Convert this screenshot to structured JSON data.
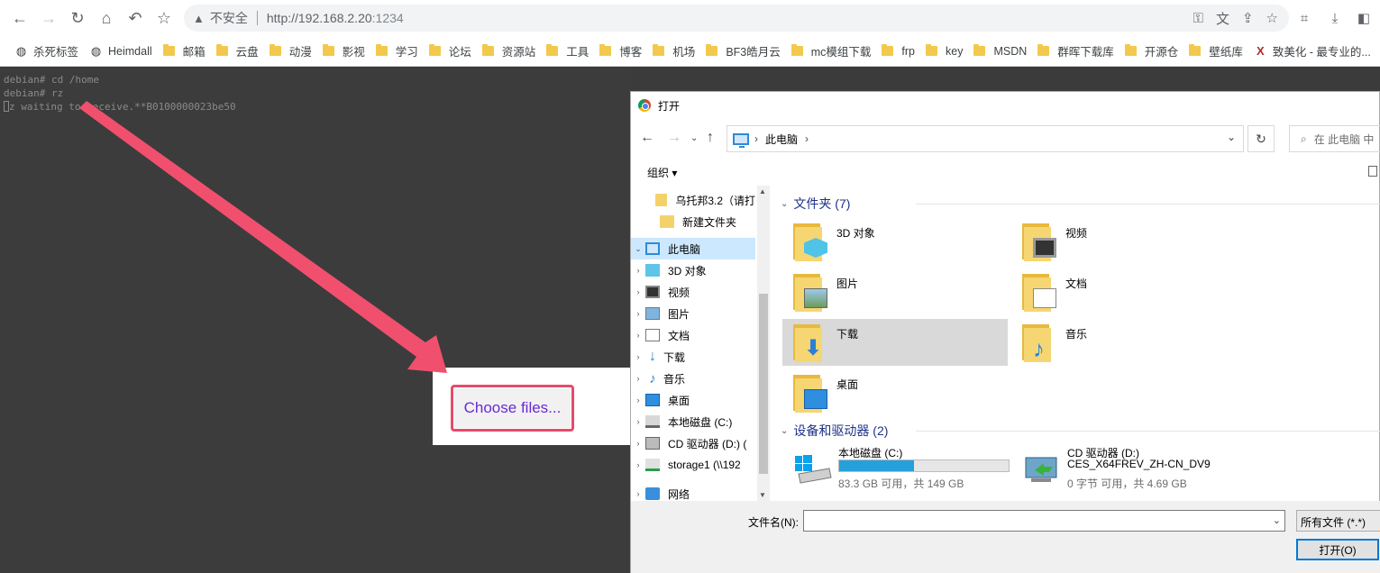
{
  "browser": {
    "security_label": "不安全",
    "url_host": "http://192.168.2.20",
    "url_port": ":1234",
    "icons": [
      "back-icon",
      "forward-icon",
      "reload-icon",
      "home-icon",
      "undo-icon",
      "star-icon"
    ]
  },
  "bookmarks": [
    {
      "label": "杀死标签",
      "icon": "globe"
    },
    {
      "label": "Heimdall",
      "icon": "globe"
    },
    {
      "label": "邮箱",
      "icon": "folder"
    },
    {
      "label": "云盘",
      "icon": "folder"
    },
    {
      "label": "动漫",
      "icon": "folder"
    },
    {
      "label": "影视",
      "icon": "folder"
    },
    {
      "label": "学习",
      "icon": "folder"
    },
    {
      "label": "论坛",
      "icon": "folder"
    },
    {
      "label": "资源站",
      "icon": "folder"
    },
    {
      "label": "工具",
      "icon": "folder"
    },
    {
      "label": "博客",
      "icon": "folder"
    },
    {
      "label": "机场",
      "icon": "folder"
    },
    {
      "label": "BF3皓月云",
      "icon": "folder"
    },
    {
      "label": "mc模组下载",
      "icon": "folder"
    },
    {
      "label": "frp",
      "icon": "folder"
    },
    {
      "label": "key",
      "icon": "folder"
    },
    {
      "label": "MSDN",
      "icon": "folder"
    },
    {
      "label": "群晖下载库",
      "icon": "folder"
    },
    {
      "label": "开源仓",
      "icon": "folder"
    },
    {
      "label": "壁纸库",
      "icon": "folder"
    },
    {
      "label": "致美化 - 最专业的...",
      "icon": "x"
    }
  ],
  "terminal": {
    "lines": [
      "debian# cd /home",
      "debian# rz",
      "rz waiting to receive.**B0100000023be50"
    ]
  },
  "upload": {
    "button_label": "Choose files..."
  },
  "dialog": {
    "title": "打开",
    "address": "此电脑",
    "address_sep": "›",
    "search_placeholder": "在 此电脑 中",
    "organize": "组织 ▾",
    "tree": [
      {
        "label": "乌托邦3.2（请打",
        "icon": "folder",
        "chev": ""
      },
      {
        "label": "新建文件夹",
        "icon": "folder",
        "chev": ""
      },
      {
        "label": "此电脑",
        "icon": "pcs",
        "chev": "⌄",
        "selected": true
      },
      {
        "label": "3D 对象",
        "icon": "3d",
        "chev": "›"
      },
      {
        "label": "视频",
        "icon": "video",
        "chev": "›"
      },
      {
        "label": "图片",
        "icon": "pic",
        "chev": "›"
      },
      {
        "label": "文档",
        "icon": "doc",
        "chev": "›"
      },
      {
        "label": "下载",
        "icon": "dl",
        "chev": "›"
      },
      {
        "label": "音乐",
        "icon": "music",
        "chev": "›"
      },
      {
        "label": "桌面",
        "icon": "desk",
        "chev": "›"
      },
      {
        "label": "本地磁盘 (C:)",
        "icon": "disk",
        "chev": "›"
      },
      {
        "label": "CD 驱动器 (D:) (",
        "icon": "cd",
        "chev": "›"
      },
      {
        "label": "storage1 (\\\\192",
        "icon": "net",
        "chev": "›"
      },
      {
        "label": "网络",
        "icon": "netw",
        "chev": "›"
      }
    ],
    "folders_header": "文件夹 (7)",
    "folders": [
      {
        "label": "3D 对象",
        "badge": "3d"
      },
      {
        "label": "视频",
        "badge": "video"
      },
      {
        "label": "图片",
        "badge": "pic"
      },
      {
        "label": "文档",
        "badge": "doc"
      },
      {
        "label": "下载",
        "badge": "dl",
        "selected": true
      },
      {
        "label": "音乐",
        "badge": "music"
      },
      {
        "label": "桌面",
        "badge": "desk"
      }
    ],
    "drives_header": "设备和驱动器 (2)",
    "drives": [
      {
        "name": "本地磁盘 (C:)",
        "size": "83.3 GB 可用，共 149 GB",
        "used_fraction": 0.44
      },
      {
        "name": "CD 驱动器 (D:)",
        "subtitle": "CES_X64FREV_ZH-CN_DV9",
        "size": "0 字节 可用，共 4.69 GB"
      }
    ],
    "filename_label": "文件名(N):",
    "filename_value": "",
    "filetype": "所有文件 (*.*)",
    "open_button": "打开(O)"
  },
  "colors": {
    "highlight_border": "#e84a6b",
    "arrow": "#f0506e",
    "link_purple": "#6a2ad6",
    "selection": "#cce8ff"
  }
}
